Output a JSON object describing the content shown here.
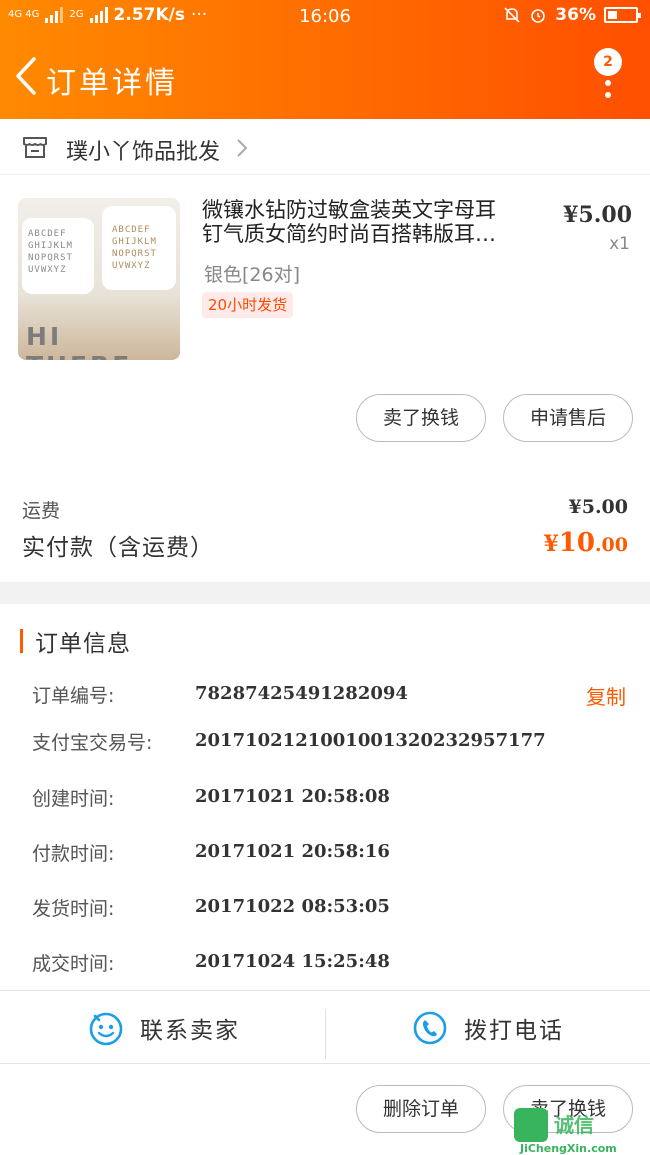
{
  "status_bar": {
    "network_left": "4G 4G",
    "network_right": "2G",
    "speed": "2.57K/s",
    "more": "···",
    "time": "16:06",
    "battery": "36%"
  },
  "nav": {
    "title": "订单详情",
    "badge_count": "2"
  },
  "shop": {
    "name": "璞小丫饰品批发"
  },
  "product": {
    "title_line1": "微镶水钻防过敏盒装英文字母耳",
    "title_line2": "钉气质女简约时尚百搭韩版耳…",
    "sku": "银色[26对]",
    "tag": "20小时发货",
    "price": "¥5.00",
    "qty": "x1",
    "image_text": "HI THERE",
    "image_letters_left": "ABCDEF GHIJKLM NOPQRST UVWXYZ",
    "image_letters_right": "ABCDEF GHIJKLM NOPQRST UVWXYZ",
    "buttons": {
      "sell": "卖了换钱",
      "after_sale": "申请售后"
    }
  },
  "totals": {
    "shipping_label": "运费",
    "shipping_value": "¥5.00",
    "paid_label": "实付款（含运费）",
    "paid_currency": "¥",
    "paid_integer": "10",
    "paid_decimal": ".00"
  },
  "order_info": {
    "title": "订单信息",
    "copy": "复制",
    "rows": [
      {
        "label": "订单编号:",
        "value": "78287425491282094"
      },
      {
        "label": "支付宝交易号:",
        "value": "2017102121001001320232957177"
      },
      {
        "label": "创建时间:",
        "value": "20171021 20:58:08"
      },
      {
        "label": "付款时间:",
        "value": "20171021 20:58:16"
      },
      {
        "label": "发货时间:",
        "value": "20171022 08:53:05"
      },
      {
        "label": "成交时间:",
        "value": "20171024 15:25:48"
      }
    ]
  },
  "contact": {
    "seller": "联系卖家",
    "call": "拨打电话"
  },
  "footer": {
    "delete": "删除订单",
    "sell": "卖了换钱"
  },
  "watermark": {
    "text": "诚信",
    "sub": "JiChengXin.com"
  },
  "colors": {
    "accent": "#ff5a00",
    "header_start": "#ff8a00",
    "header_end": "#ff4f00",
    "contact_icon": "#1a9ee6"
  }
}
